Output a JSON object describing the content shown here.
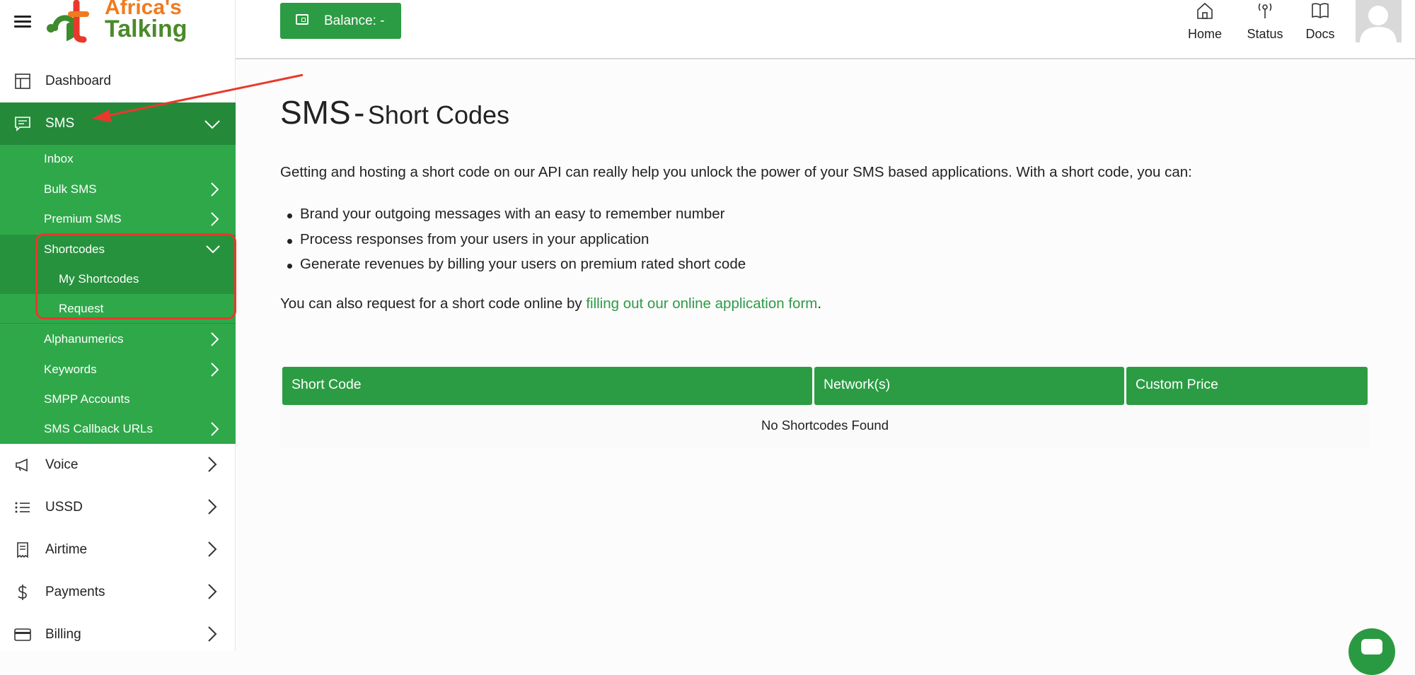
{
  "app": {
    "brand_line1": "Africa's",
    "brand_line2": "Talking"
  },
  "sidebar": {
    "top_items": [
      {
        "label": "Dashboard",
        "icon": "dashboard-icon"
      }
    ],
    "sms": {
      "label": "SMS",
      "icon": "message-icon",
      "expanded": true
    },
    "sms_children": [
      {
        "label": "Inbox"
      },
      {
        "label": "Bulk SMS"
      },
      {
        "label": "Premium SMS"
      },
      {
        "label": "Shortcodes",
        "expanded": true
      },
      {
        "label": "My Shortcodes"
      },
      {
        "label": "Request"
      },
      {
        "label": "Alphanumerics"
      },
      {
        "label": "Keywords"
      },
      {
        "label": "SMPP Accounts"
      },
      {
        "label": "SMS Callback URLs"
      }
    ],
    "bottom_items": [
      {
        "label": "Voice",
        "icon": "megaphone-icon"
      },
      {
        "label": "USSD",
        "icon": "list-icon"
      },
      {
        "label": "Airtime",
        "icon": "receipt-icon"
      },
      {
        "label": "Payments",
        "icon": "dollar-icon"
      },
      {
        "label": "Billing",
        "icon": "credit-card-icon"
      }
    ]
  },
  "topbar": {
    "balance_label": "Balance: -",
    "nav": [
      {
        "label": "Home",
        "icon": "home-icon"
      },
      {
        "label": "Status",
        "icon": "antenna-icon"
      },
      {
        "label": "Docs",
        "icon": "book-icon"
      }
    ]
  },
  "main": {
    "title": "SMS",
    "title_sep": "-",
    "subtitle": "Short Codes",
    "intro": "Getting and hosting a short code on our API can really help you unlock the power of your SMS based applications. With a short code, you can:",
    "bullets": [
      "Brand your outgoing messages with an easy to remember number",
      "Process responses from your users in your application",
      "Generate revenues by billing your users on premium rated short code"
    ],
    "request_prefix": "You can also request for a short code online by ",
    "request_link": "filling out our online application form",
    "request_suffix": ".",
    "table": {
      "columns": [
        "Short Code",
        "Network(s)",
        "Custom Price"
      ],
      "empty_message": "No Shortcodes Found"
    }
  },
  "colors": {
    "brand_green": "#2b9c43",
    "sidebar_green": "#2fa84a",
    "sidebar_dark_green": "#248a3a",
    "annotation_red": "#e8392b",
    "link_green": "#2f9a46"
  }
}
